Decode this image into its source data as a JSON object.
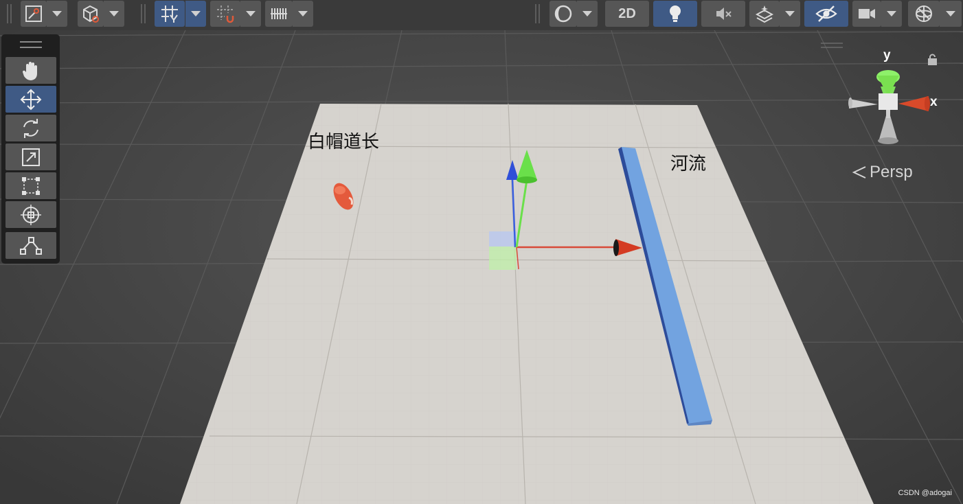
{
  "toolbar": {
    "view_2d_label": "2D",
    "items": [
      "gizmo-tool",
      "object-shading",
      "grid-snapping",
      "snap-increment",
      "ruler-grid",
      "draw-mode",
      "2d-toggle",
      "lighting",
      "audio",
      "effects",
      "scene-visibility",
      "camera",
      "gizmos"
    ]
  },
  "palette": {
    "tools": [
      "hand-tool",
      "move-tool",
      "rotate-tool",
      "scale-tool",
      "rect-tool",
      "transform-tool",
      "custom-tool"
    ],
    "active": "move-tool"
  },
  "scene": {
    "character_label": "白帽道长",
    "river_label": "河流",
    "projection_label": "Persp",
    "axis_y": "y",
    "axis_x": "x"
  },
  "colors": {
    "active_button": "#3f5a85",
    "ground": "#d6d3ce",
    "river": "#6f9fdc",
    "character": "#e45a3c",
    "axis_x": "#d43b23",
    "axis_y": "#6ae04a",
    "axis_z": "#3a5fe0"
  },
  "watermark": "CSDN @adogai"
}
